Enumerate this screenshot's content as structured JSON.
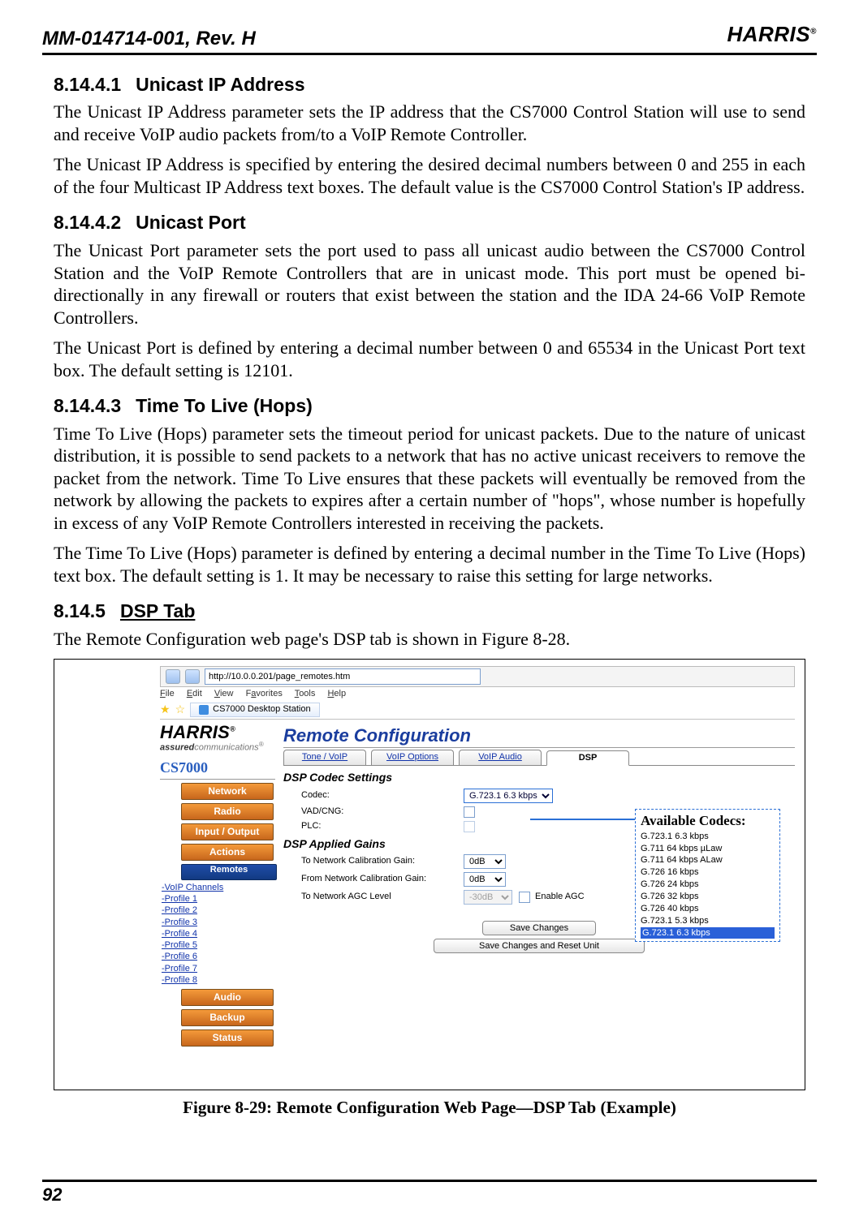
{
  "header": {
    "docid": "MM-014714-001, Rev. H",
    "brand": "HARRIS",
    "reg": "®"
  },
  "page_number": "92",
  "sections": {
    "s1": {
      "num": "8.14.4.1",
      "title": "Unicast IP Address",
      "p1": "The Unicast IP Address parameter sets the IP address that the CS7000 Control Station will use to send and receive VoIP audio packets from/to a VoIP Remote Controller.",
      "p2": "The Unicast IP Address is specified by entering the desired decimal numbers between 0 and 255 in each of the four Multicast IP Address text boxes. The default value is the CS7000 Control Station's IP address."
    },
    "s2": {
      "num": "8.14.4.2",
      "title": "Unicast Port",
      "p1": "The Unicast Port parameter sets the port used to pass all unicast audio between the CS7000 Control Station and the VoIP Remote Controllers that are in unicast mode. This port must be opened bi-directionally in any firewall or routers that exist between the station and the IDA 24-66 VoIP Remote Controllers.",
      "p2": "The Unicast Port is defined by entering a decimal number between 0 and 65534 in the Unicast Port text box.  The default setting is 12101."
    },
    "s3": {
      "num": "8.14.4.3",
      "title": "Time To Live (Hops)",
      "p1": "Time To Live (Hops) parameter sets the timeout period for unicast packets. Due to the nature of unicast distribution, it is possible to send packets to a network that has no active unicast receivers to remove the packet from the network.  Time To Live ensures that these packets will eventually be removed from the network by allowing the packets to expires after a certain number of \"hops\", whose number is hopefully in excess of any VoIP Remote Controllers interested in receiving the packets.",
      "p2": "The Time To Live (Hops) parameter is defined by entering a decimal number in the Time To Live (Hops) text box. The default setting is 1.  It may be necessary to raise this setting for large networks."
    },
    "s4": {
      "num": "8.14.5",
      "title": "DSP Tab",
      "p1": "The Remote Configuration web page's DSP tab is shown in Figure 8-28."
    }
  },
  "figure": {
    "caption": "Figure 8-29:  Remote Configuration Web Page—DSP Tab (Example)",
    "browser": {
      "url": "http://10.0.0.201/page_remotes.htm",
      "menu": {
        "file": "File",
        "edit": "Edit",
        "view": "View",
        "favorites": "Favorites",
        "tools": "Tools",
        "help": "Help"
      },
      "tab_title": "CS7000 Desktop Station"
    },
    "brand": {
      "logo": "HARRIS",
      "reg": "®",
      "tag1": "assured",
      "tag2": "communications",
      "product": "CS7000"
    },
    "nav": {
      "items": [
        "Network",
        "Radio",
        "Input / Output",
        "Actions",
        "Remotes",
        "Audio",
        "Backup",
        "Status"
      ],
      "sublinks": [
        "-VoIP Channels",
        "-Profile 1",
        "-Profile 2",
        "-Profile 3",
        "-Profile 4",
        "-Profile 5",
        "-Profile 6",
        "-Profile 7",
        "-Profile 8"
      ]
    },
    "panel": {
      "title": "Remote Configuration",
      "tabs": [
        "Tone / VoIP",
        "VoIP Options",
        "VoIP Audio",
        "DSP"
      ],
      "active_tab": 3,
      "group1": "DSP Codec Settings",
      "rows1": {
        "codec_lbl": "Codec:",
        "codec_val": "G.723.1 6.3 kbps",
        "vad_lbl": "VAD/CNG:",
        "plc_lbl": "PLC:"
      },
      "group2": "DSP Applied Gains",
      "rows2": {
        "tn_lbl": "To Network Calibration Gain:",
        "tn_val": "0dB",
        "fn_lbl": "From Network Calibration Gain:",
        "fn_val": "0dB",
        "agc_lbl": "To Network AGC Level",
        "agc_val": "-30dB",
        "agc_enable": "Enable AGC"
      },
      "save": "Save Changes",
      "save_reset": "Save Changes and Reset Unit"
    },
    "callout": {
      "title": "Available Codecs:",
      "options": [
        "G.723.1 6.3 kbps",
        "G.711 64 kbps µLaw",
        "G.711 64 kbps ALaw",
        "G.726 16 kbps",
        "G.726 24 kbps",
        "G.726 32 kbps",
        "G.726 40 kbps",
        "G.723.1 5.3 kbps",
        "G.723.1 6.3 kbps"
      ],
      "selected_index": 8
    }
  }
}
